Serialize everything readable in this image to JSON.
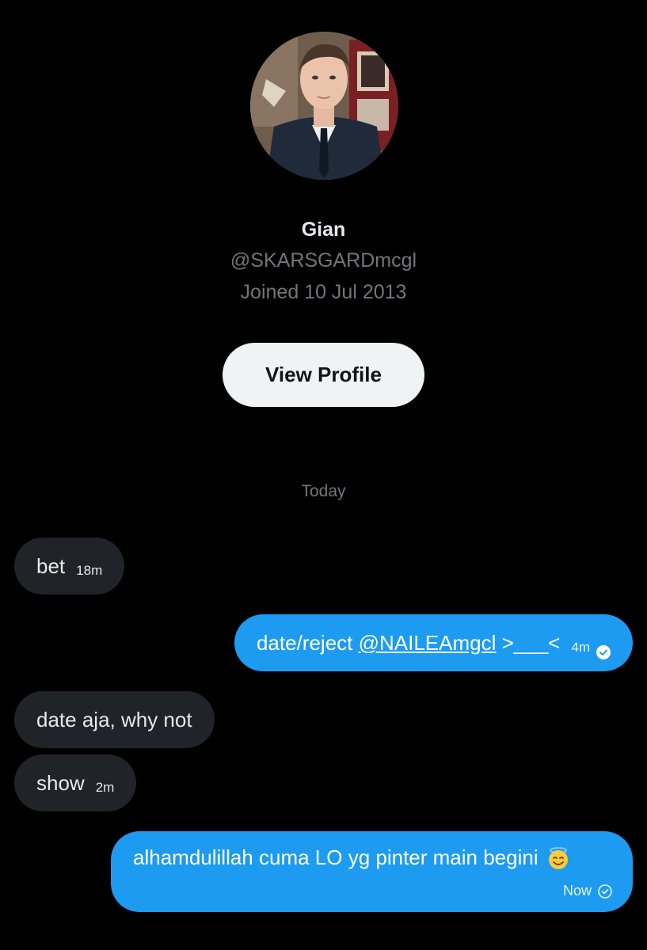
{
  "profile": {
    "name": "Gian",
    "handle": "@SKARSGARDmcgl",
    "joined": "Joined 10 Jul 2013",
    "view_profile_label": "View Profile"
  },
  "date_separator": "Today",
  "messages": [
    {
      "direction": "received",
      "text": "bet",
      "time": "18m"
    },
    {
      "direction": "sent",
      "text_before": "date/reject ",
      "mention": "@NAILEAmgcl",
      "text_after": " >___<",
      "time": "4m",
      "status_icon": "read-check-icon"
    },
    {
      "direction": "received",
      "text": "date aja, why not",
      "time": ""
    },
    {
      "direction": "received",
      "text": "show",
      "time": "2m"
    },
    {
      "direction": "sent",
      "text": "alhamdulillah cuma LO yg pinter main begini",
      "emoji": "smiling-face-with-halo",
      "time": "Now",
      "status_icon": "sent-check-icon"
    }
  ],
  "colors": {
    "background": "#000000",
    "sent_bubble": "#1d9bf0",
    "received_bubble": "#202327",
    "muted_text": "#71767b",
    "button_bg": "#eff3f4"
  }
}
